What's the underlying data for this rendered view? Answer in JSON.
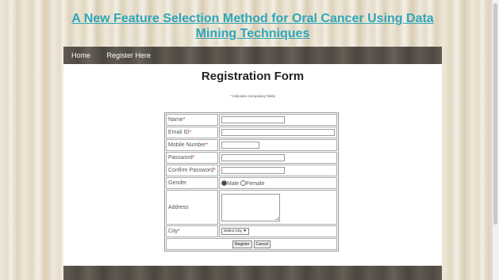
{
  "site_title": "A New Feature Selection Method for Oral Cancer Using Data Mining Techniques",
  "nav": {
    "items": [
      {
        "label": "Home"
      },
      {
        "label": "Register Here"
      }
    ]
  },
  "form": {
    "title": "Registration Form",
    "note": "* indicates compulsory fields",
    "fields": {
      "name": {
        "label": "Name",
        "required_mark": "*"
      },
      "email": {
        "label": "Email ID",
        "required_mark": "*"
      },
      "mobile": {
        "label": "Mobile Number",
        "required_mark": "*"
      },
      "password": {
        "label": "Password",
        "required_mark": "*"
      },
      "confirm_password": {
        "label": "Confirm Password",
        "required_mark": "*"
      },
      "gender": {
        "label": "Gender",
        "options": [
          {
            "label": "Male",
            "selected": true
          },
          {
            "label": "Female",
            "selected": false
          }
        ]
      },
      "address": {
        "label": "Address"
      },
      "city": {
        "label": "City",
        "required_mark": "*",
        "selected_value": "Select City",
        "arrow": "▼"
      }
    },
    "buttons": {
      "register": "Register",
      "cancel": "Cancel"
    }
  },
  "colors": {
    "title_link": "#2ea6b8",
    "required": "#d63b3b",
    "nav_bg": "#564f47"
  }
}
